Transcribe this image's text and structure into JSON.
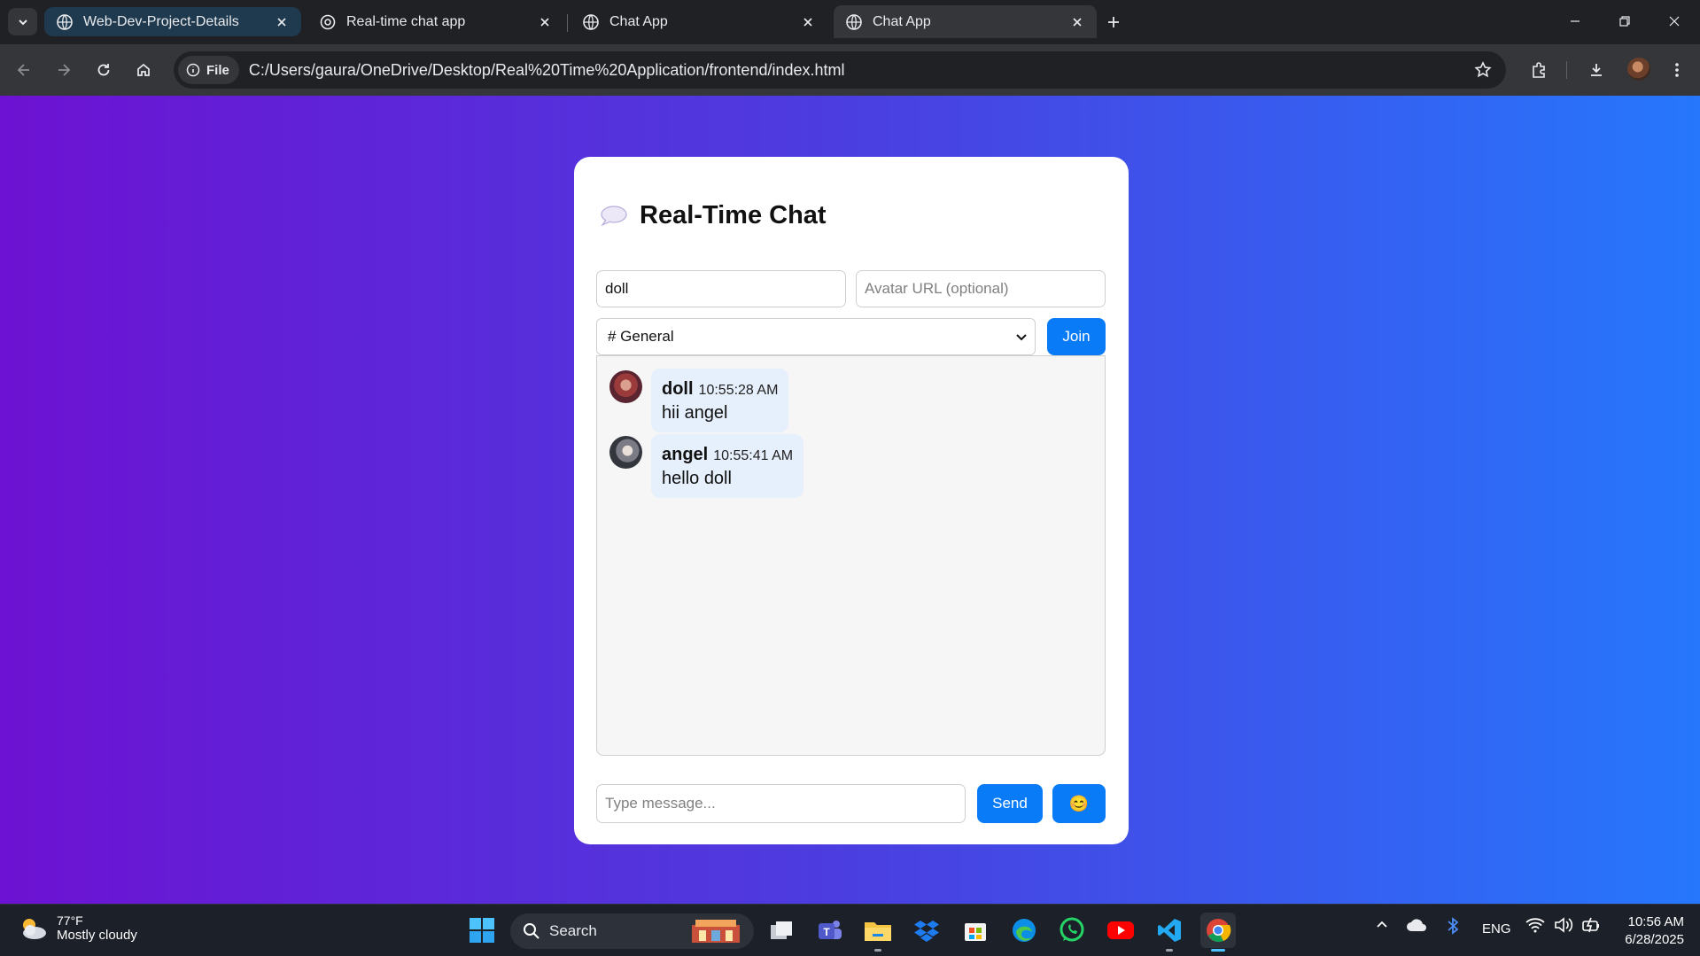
{
  "browser": {
    "tabs": [
      {
        "title": "Web-Dev-Project-Details"
      },
      {
        "title": "Real-time chat app"
      },
      {
        "title": "Chat App"
      },
      {
        "title": "Chat App"
      }
    ],
    "address": {
      "scheme_label": "File",
      "url": "C:/Users/gaura/OneDrive/Desktop/Real%20Time%20Application/frontend/index.html"
    }
  },
  "page": {
    "title": "Real-Time Chat",
    "name_value": "doll",
    "avatar_placeholder": "Avatar URL (optional)",
    "room_selected": "# General",
    "join_label": "Join",
    "messages": [
      {
        "user": "doll",
        "time": "10:55:28 AM",
        "text": "hii angel"
      },
      {
        "user": "angel",
        "time": "10:55:41 AM",
        "text": "hello doll"
      }
    ],
    "message_placeholder": "Type message...",
    "send_label": "Send",
    "emoji_label": "😊"
  },
  "taskbar": {
    "weather_temp": "77°F",
    "weather_desc": "Mostly cloudy",
    "search_label": "Search",
    "language": "ENG",
    "time": "10:56 AM",
    "date": "6/28/2025"
  },
  "colors": {
    "gradient_start": "#6d12d2",
    "gradient_end": "#2677fc",
    "accent": "#0a7bf6",
    "bubble": "#e6effc"
  }
}
